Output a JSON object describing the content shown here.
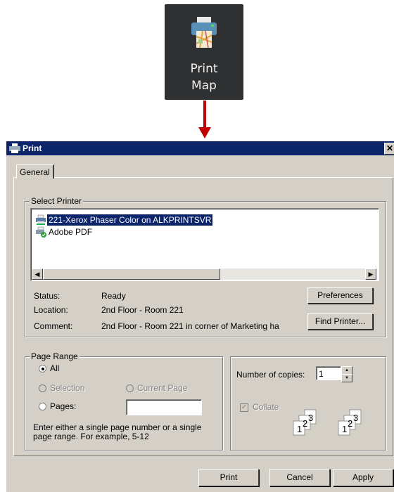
{
  "toolbar_button": {
    "line1": "Print",
    "line2": "Map",
    "icon": "printer-map-icon"
  },
  "dialog": {
    "title": "Print",
    "close_glyph": "✕",
    "tab": "General",
    "select_printer": {
      "legend": "Select Printer",
      "printers": [
        {
          "name": "221-Xerox Phaser Color on ALKPRINTSVR",
          "selected": true,
          "icon": "network-printer-icon"
        },
        {
          "name": "Adobe PDF",
          "selected": false,
          "icon": "default-printer-icon"
        }
      ],
      "scroll_left": "◀",
      "scroll_right": "▶",
      "status_label": "Status:",
      "status_value": "Ready",
      "location_label": "Location:",
      "location_value": "2nd Floor - Room 221",
      "comment_label": "Comment:",
      "comment_value": "2nd Floor - Room 221 in corner of Marketing ha",
      "preferences_button": "Preferences",
      "find_printer_button": "Find Printer..."
    },
    "page_range": {
      "legend": "Page Range",
      "all": "All",
      "selection": "Selection",
      "current_page": "Current Page",
      "pages": "Pages:",
      "pages_value": "",
      "hint_line1": "Enter either a single page number or a single",
      "hint_line2": "page range.  For example, 5-12"
    },
    "copies": {
      "label": "Number of copies:",
      "value": "1",
      "collate": "Collate",
      "collate_checked": true,
      "collate_icon_pages": [
        "1",
        "2",
        "3"
      ]
    },
    "buttons": {
      "print": "Print",
      "cancel": "Cancel",
      "apply": "Apply"
    }
  },
  "colors": {
    "titlebar": "#0b246a",
    "dialog_bg": "#d4d0c8",
    "arrow": "#c00000",
    "toolbar_bg": "#2e3032"
  }
}
